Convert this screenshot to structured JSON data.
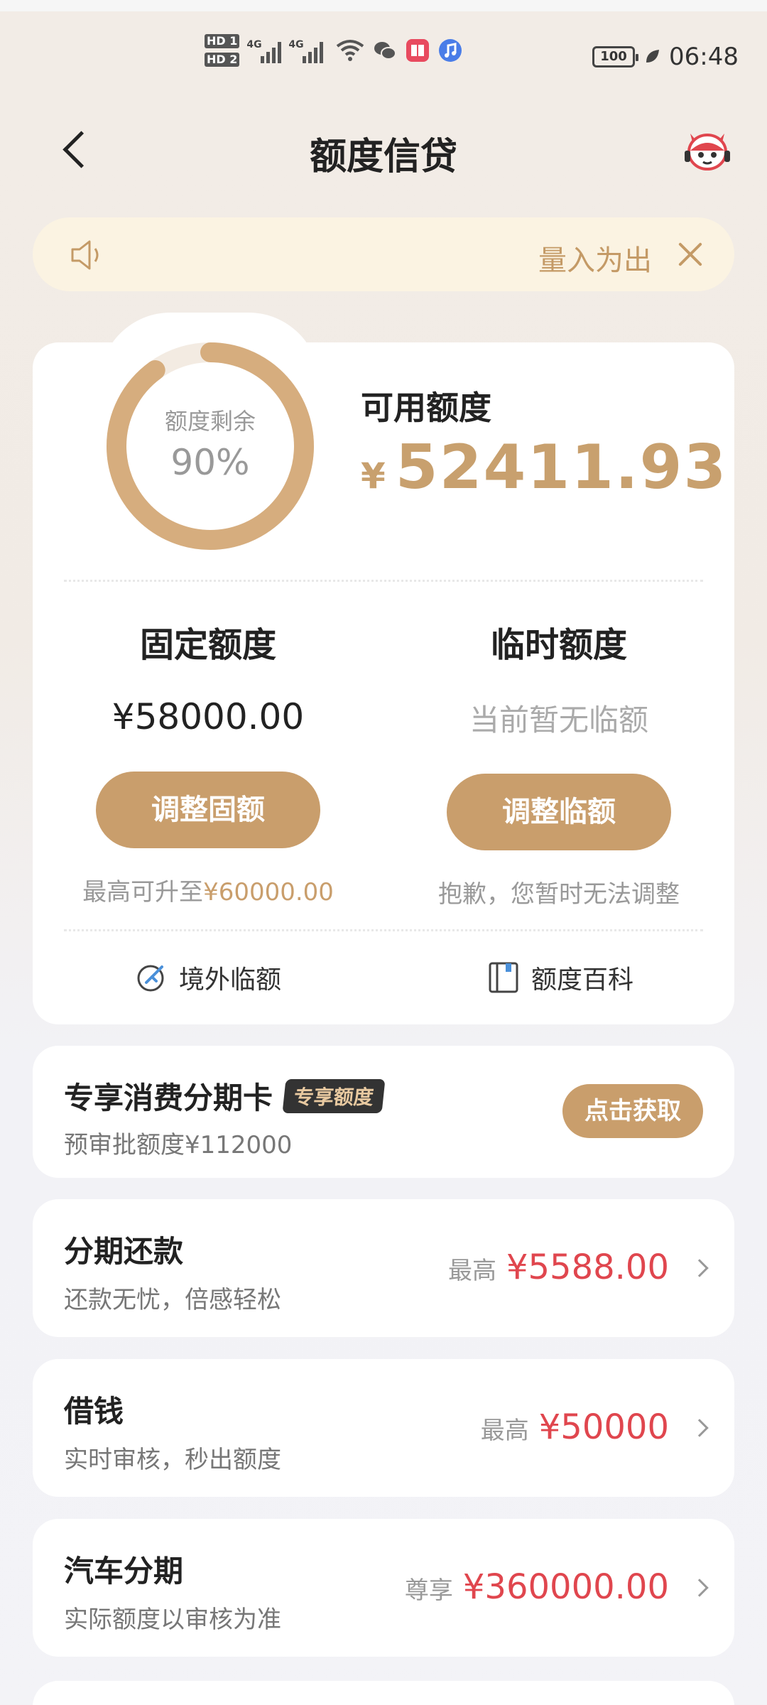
{
  "status_bar": {
    "hd1": "HD 1",
    "hd2": "HD 2",
    "net1": "4G",
    "net2": "4G",
    "battery": "100",
    "time": "06:48"
  },
  "nav": {
    "title": "额度信贷"
  },
  "notice": {
    "text": "量入为出"
  },
  "quota": {
    "ring_label": "额度剩余",
    "ring_value": "90%",
    "ring_fraction": 0.9,
    "available_label": "可用额度",
    "currency": "¥",
    "available_value": "52411.93"
  },
  "fixed": {
    "title": "固定额度",
    "amount": "¥58000.00",
    "button": "调整固额",
    "note_prefix": "最高可升至",
    "note_value": "¥60000.00"
  },
  "temporary": {
    "title": "临时额度",
    "amount": "当前暂无临额",
    "button": "调整临额",
    "note": "抱歉，您暂时无法调整"
  },
  "links": {
    "overseas": "境外临额",
    "wiki": "额度百科"
  },
  "promo": {
    "title": "专享消费分期卡",
    "badge": "专享额度",
    "sub": "预审批额度¥112000",
    "button": "点击获取"
  },
  "list": [
    {
      "title": "分期还款",
      "sub": "还款无忧，倍感轻松",
      "pre": "最高",
      "amount": "¥5588.00"
    },
    {
      "title": "借钱",
      "sub": "实时审核，秒出额度",
      "pre": "最高",
      "amount": "¥50000"
    },
    {
      "title": "汽车分期",
      "sub": "实际额度以审核为准",
      "pre": "尊享",
      "amount": "¥360000.00"
    }
  ],
  "colors": {
    "accent": "#c99e6c",
    "amount_red": "#e0464e",
    "notice_bg": "#fbf3e2"
  }
}
